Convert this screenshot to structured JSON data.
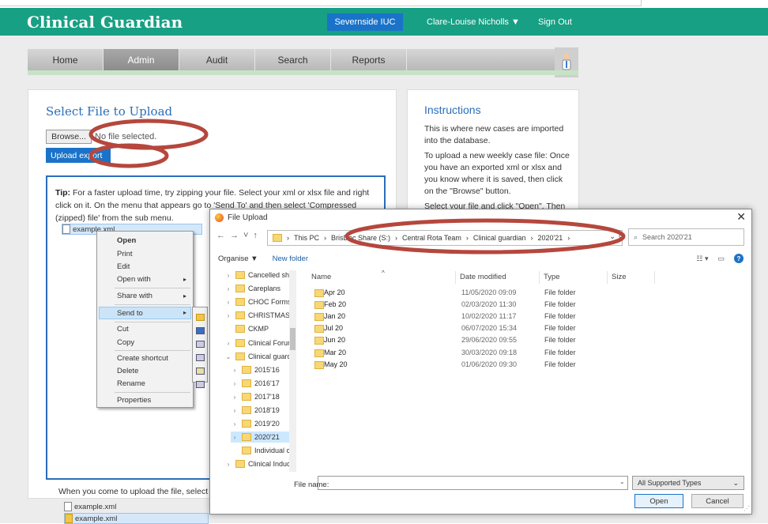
{
  "app": {
    "title": "Clinical Guardian",
    "org": "Severnside IUC",
    "user": "Clare-Louise Nicholls ▼",
    "signout": "Sign Out"
  },
  "nav": [
    "Home",
    "Admin",
    "Audit",
    "Search",
    "Reports"
  ],
  "upload": {
    "title": "Select File to Upload",
    "browse": "Browse...",
    "nofile": "No file selected.",
    "button": "Upload export"
  },
  "tip": {
    "label": "Tip:",
    "text": "For a faster upload time, try zipping your file. Select your xml or xlsx file and right click on it. On the menu that appears go to 'Send To' and then select 'Compressed (zipped) file' from the sub menu.",
    "file1": "example.xml",
    "when": "When you come to upload the file, select the",
    "file2": "example.xml",
    "file3": "example.xml"
  },
  "instructions": {
    "title": "Instructions",
    "p1": "This is where new cases are imported into the database.",
    "p2": "To upload a new weekly case file: Once you have an exported xml or xlsx and you know where it is saved, then click on the \"Browse\" button.",
    "p3": "Select your file and click \"Open\". Then"
  },
  "context_menu": {
    "open": "Open",
    "print": "Print",
    "edit": "Edit",
    "open_with": "Open with",
    "share_with": "Share with",
    "send_to": "Send to",
    "cut": "Cut",
    "copy": "Copy",
    "create_shortcut": "Create shortcut",
    "delete": "Delete",
    "rename": "Rename",
    "properties": "Properties"
  },
  "dialog": {
    "title": "File Upload",
    "path": [
      "This PC",
      "BrisDoc Share (S:)",
      "Central Rota Team",
      "Clinical guardian",
      "2020'21"
    ],
    "search": "Search 2020'21",
    "organise": "Organise ▼",
    "newfolder": "New folder",
    "tree": [
      "Cancelled shi",
      "Careplans",
      "CHOC Forms",
      "CHRISTMAS I",
      "CKMP",
      "Clinical Forur",
      "Clinical guarc",
      "2015'16",
      "2016'17",
      "2017'18",
      "2018'19",
      "2019'20",
      "2020'21",
      "Individual c",
      "Clinical Induc"
    ],
    "columns": {
      "name": "Name",
      "date": "Date modified",
      "type": "Type",
      "size": "Size"
    },
    "files": [
      {
        "name": "Apr 20",
        "date": "11/05/2020 09:09",
        "type": "File folder"
      },
      {
        "name": "Feb 20",
        "date": "02/03/2020 11:30",
        "type": "File folder"
      },
      {
        "name": "Jan 20",
        "date": "10/02/2020 11:17",
        "type": "File folder"
      },
      {
        "name": "Jul 20",
        "date": "06/07/2020 15:34",
        "type": "File folder"
      },
      {
        "name": "Jun 20",
        "date": "29/06/2020 09:55",
        "type": "File folder"
      },
      {
        "name": "Mar 20",
        "date": "30/03/2020 09:18",
        "type": "File folder"
      },
      {
        "name": "May 20",
        "date": "01/06/2020 09:30",
        "type": "File folder"
      }
    ],
    "filename_label": "File name:",
    "filetypes": "All Supported Types",
    "open": "Open",
    "cancel": "Cancel"
  },
  "colors": {
    "header": "#17a084",
    "link": "#2a6ebb",
    "button": "#1a73c8",
    "annotation": "#b5473d"
  }
}
